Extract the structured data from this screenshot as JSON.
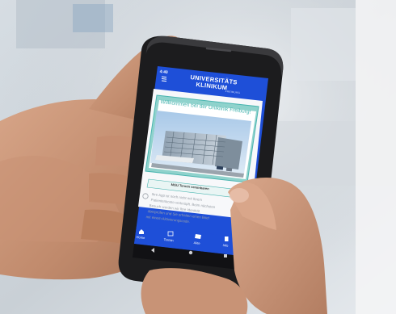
{
  "status_bar": {
    "time": "4:40"
  },
  "header": {
    "brand_line1": "UNIVERSITÄTS",
    "brand_line2": "KLINIKUM",
    "brand_line3": "FREIBURG"
  },
  "welcome_card": {
    "title": "Willkommen bei der Uniklinik Freiburg!",
    "button_label": "MGU Termin vereinbaren"
  },
  "info": {
    "lines": [
      "Ihre App ist noch nicht mit Ihrem",
      "Patientenkonto verknüpft. Beim nächsten",
      "Besuch werden wir Ihre Identität",
      "überprüfen und Sie erhalten einen Brief",
      "mit einem Aktivierungscode."
    ]
  },
  "bottom_nav": {
    "items": [
      {
        "label": "Home",
        "icon": "home-icon"
      },
      {
        "label": "Termin",
        "icon": "calendar-icon"
      },
      {
        "label": "Akte",
        "icon": "folder-icon"
      },
      {
        "label": "Info",
        "icon": "document-icon"
      }
    ]
  },
  "colors": {
    "app_blue": "#1e4fd8",
    "teal": "#4ab5b0",
    "phone_body": "#1c1c1e"
  }
}
